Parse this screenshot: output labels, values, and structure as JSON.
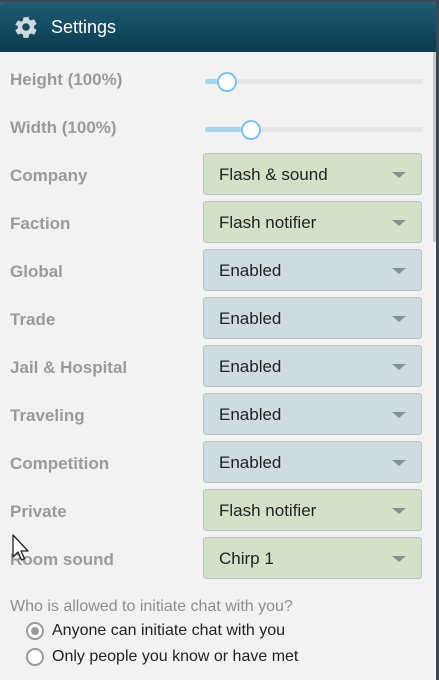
{
  "header": {
    "title": "Settings",
    "icon": "gear-icon"
  },
  "sliders": [
    {
      "label": "Height (100%)",
      "value": 0.1
    },
    {
      "label": "Width (100%)",
      "value": 0.21
    }
  ],
  "selects": [
    {
      "label": "Company",
      "value": "Flash & sound",
      "theme": "green"
    },
    {
      "label": "Faction",
      "value": "Flash notifier",
      "theme": "green"
    },
    {
      "label": "Global",
      "value": "Enabled",
      "theme": "blue"
    },
    {
      "label": "Trade",
      "value": "Enabled",
      "theme": "blue"
    },
    {
      "label": "Jail & Hospital",
      "value": "Enabled",
      "theme": "blue"
    },
    {
      "label": "Traveling",
      "value": "Enabled",
      "theme": "blue"
    },
    {
      "label": "Competition",
      "value": "Enabled",
      "theme": "blue"
    },
    {
      "label": "Private",
      "value": "Flash notifier",
      "theme": "green"
    },
    {
      "label": "Room sound",
      "value": "Chirp 1",
      "theme": "green"
    }
  ],
  "chat_permission": {
    "question": "Who is allowed to initiate chat with you?",
    "options": [
      {
        "label": "Anyone can initiate chat with you",
        "checked": true
      },
      {
        "label": "Only people you know or have met",
        "checked": false
      }
    ]
  },
  "colors": {
    "header_top": "#1e5d75",
    "header_bottom": "#0b3a4d",
    "select_green": "#d5e0c9",
    "select_blue": "#cedce0",
    "slider_accent": "#7fc2e6"
  }
}
